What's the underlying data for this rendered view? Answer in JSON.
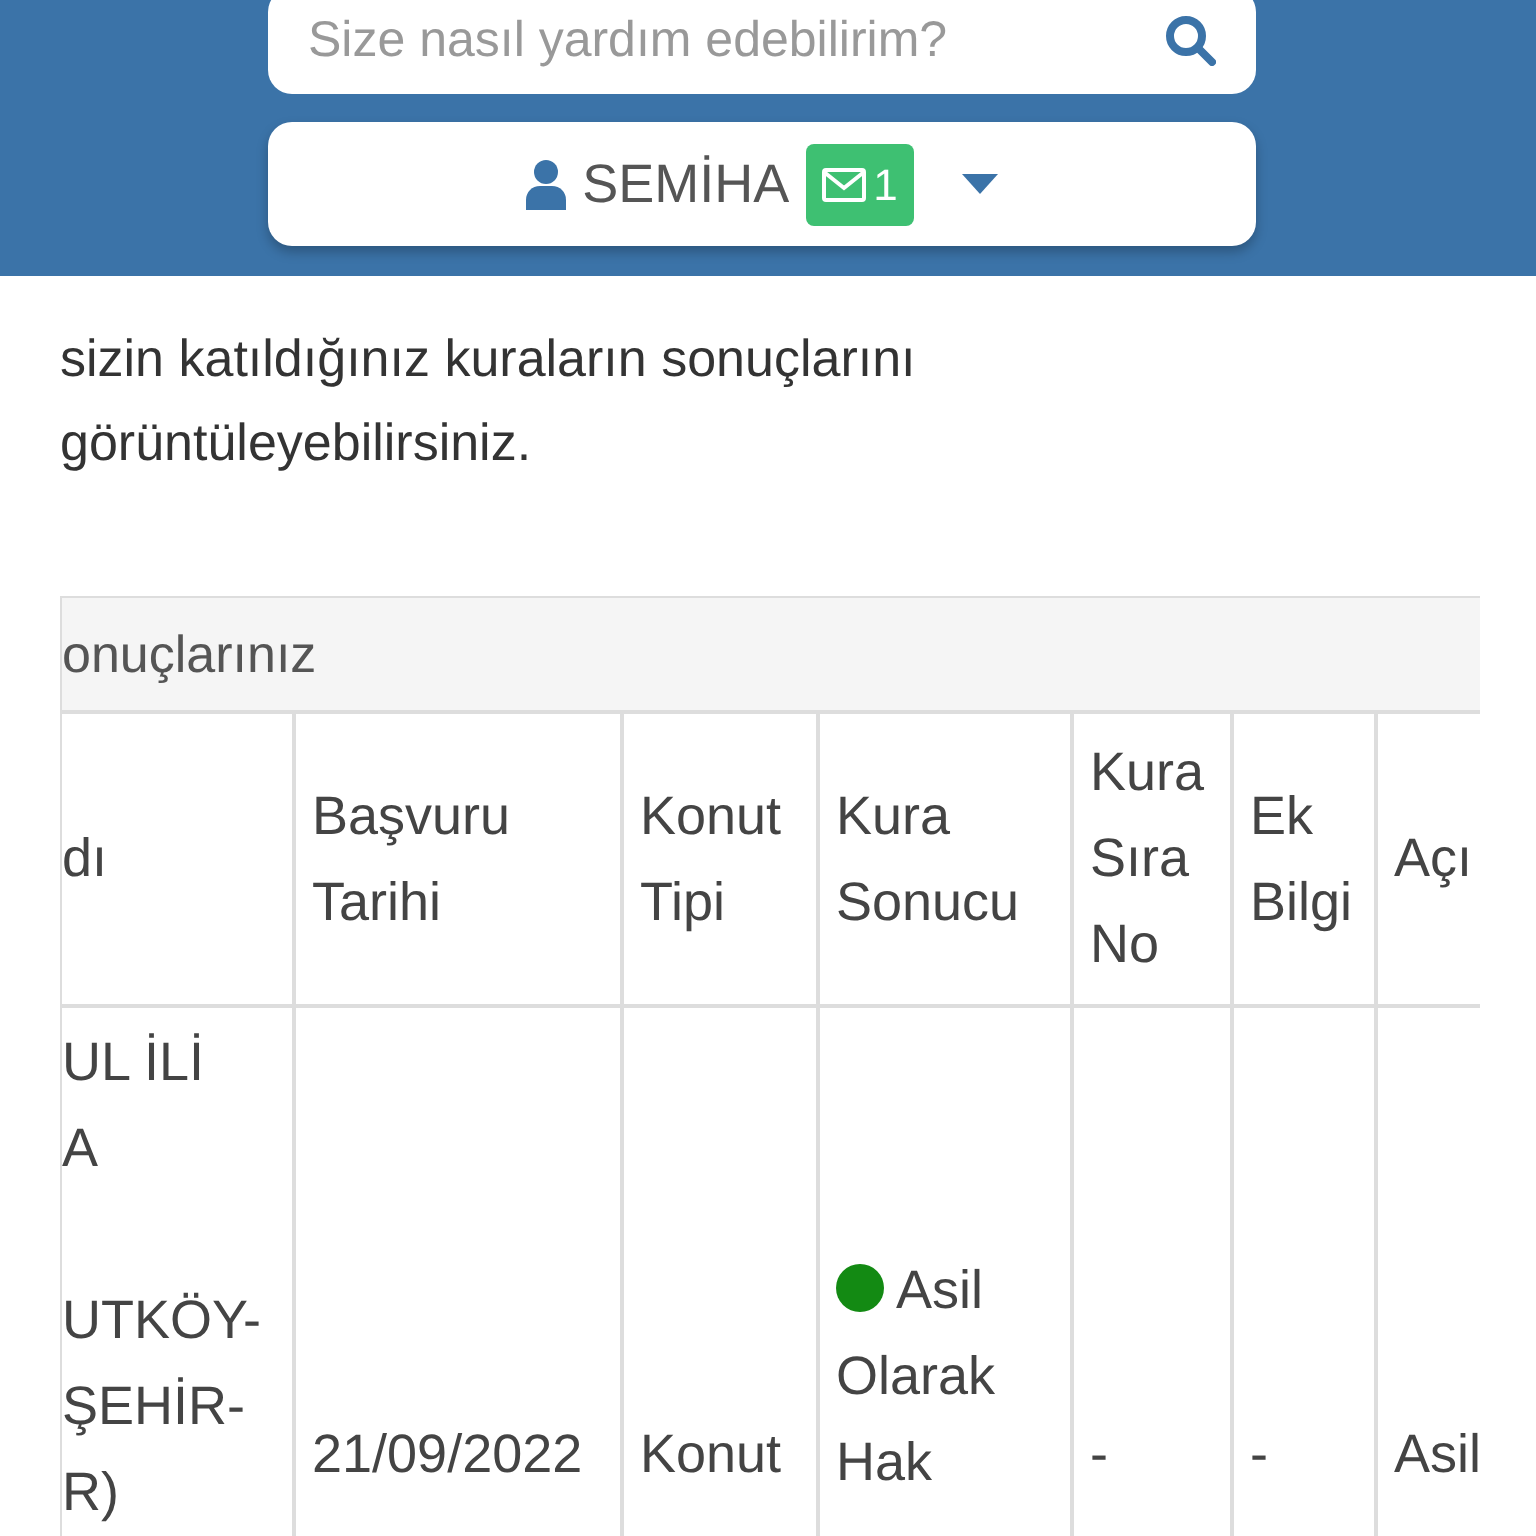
{
  "header": {
    "search": {
      "placeholder": "Size nasıl yardım edebilirim?"
    },
    "user_menu": {
      "name": "SEMİHA",
      "message_count": "1"
    }
  },
  "intro": "sizin katıldığınız kuraların sonuçlarını görüntüleyebilirsiniz.",
  "results_panel": {
    "title": "onuçlarınız",
    "table": {
      "columns": [
        "dı",
        "Başvuru Tarihi",
        "Konut Tipi",
        "Kura Sonucu",
        "Kura Sıra No",
        "Ek Bilgi",
        "Açı"
      ],
      "rows": [
        {
          "cells": [
            {
              "kind": "lines",
              "groups": [
                [
                  "UL İLİ",
                  "A"
                ],
                [
                  "UTKÖY-",
                  "ŞEHİR-",
                  "R)"
                ]
              ]
            },
            {
              "kind": "text",
              "text": "21/09/2022"
            },
            {
              "kind": "text",
              "text": "Konut"
            },
            {
              "kind": "status",
              "text": "Asil Olarak Hak",
              "color": "#138a13"
            },
            {
              "kind": "text",
              "text": "-"
            },
            {
              "kind": "text",
              "text": "-"
            },
            {
              "kind": "text",
              "text": "Asil"
            }
          ]
        }
      ]
    }
  }
}
